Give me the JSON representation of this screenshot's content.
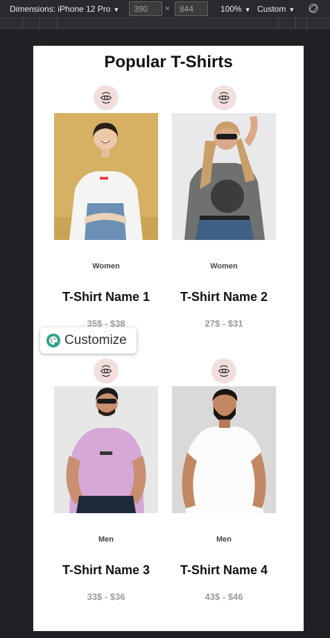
{
  "devtools": {
    "dimensions_label": "Dimensions: iPhone 12 Pro",
    "width": "390",
    "height": "844",
    "times": "×",
    "zoom": "100%",
    "throttle": "Custom"
  },
  "page": {
    "heading": "Popular T-Shirts",
    "customize_label": "Customize",
    "products": [
      {
        "category": "Women",
        "name": "T-Shirt Name 1",
        "price": "35$ - $38"
      },
      {
        "category": "Women",
        "name": "T-Shirt Name 2",
        "price": "27$ - $31"
      },
      {
        "category": "Men",
        "name": "T-Shirt Name 3",
        "price": "33$ - $36"
      },
      {
        "category": "Men",
        "name": "T-Shirt Name 4",
        "price": "43$ - $46"
      }
    ]
  },
  "icons": {
    "quick_view": "eye-refresh-icon",
    "customize": "palette-icon",
    "rotate": "rotate-icon"
  },
  "colors": {
    "icon_circle": "#f3dede",
    "customize_accent": "#2ea58a",
    "price": "#999999"
  }
}
